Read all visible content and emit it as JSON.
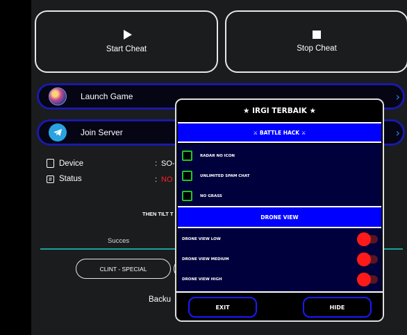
{
  "buttons": {
    "start": "Start Cheat",
    "stop": "Stop Cheat"
  },
  "launch_game": {
    "label": "Launch Game",
    "chevron": "›"
  },
  "join_server": {
    "label": "Join Server",
    "chevron": "›"
  },
  "info": {
    "device_label": "Device",
    "device_value": "SO-0",
    "status_label": "Status",
    "status_value": "NO",
    "separator": ":"
  },
  "hint_text": "THEN TILT T",
  "status_tab": "Succes",
  "clint_button": "CLINT - SPECIAL",
  "backup_label": "Backu",
  "menu": {
    "title": "★ IRGI TERBAIK ★",
    "section1": "⚔ BATTLE HACK ⚔",
    "checks": [
      "RADAR NO ICON",
      "UNLIMITED SPAM CHAT",
      "NO GRASS"
    ],
    "section2": "DRONE VIEW",
    "toggles": [
      "DRONE VIEW LOW",
      "DRONE VIEW MEDIUM",
      "DRONE VIEW HIGH"
    ],
    "exit": "EXIT",
    "hide": "HIDE"
  },
  "colors": {
    "accent_blue": "#0000ff",
    "check_green": "#25c425",
    "toggle_red": "#ff1a1a",
    "status_red": "#ff2020",
    "divider_teal": "#1aa39a"
  }
}
